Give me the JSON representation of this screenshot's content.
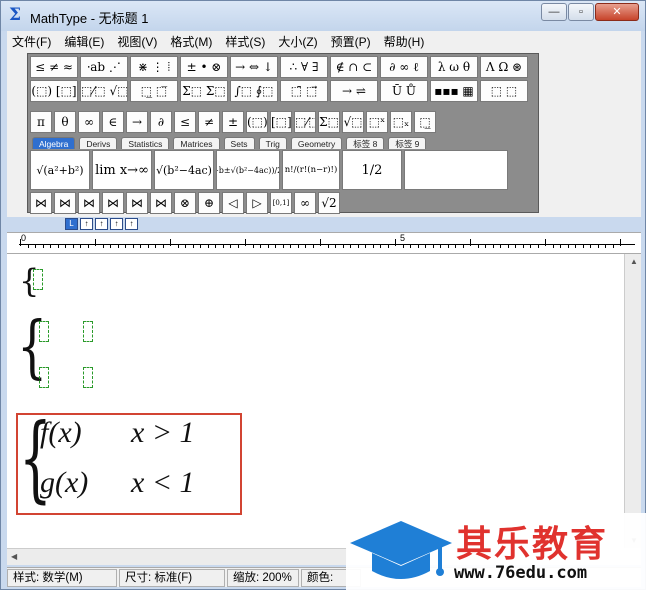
{
  "window": {
    "app_name": "MathType",
    "title": "MathType - 无标题 1",
    "controls": {
      "minimize": "—",
      "maximize": "▫",
      "close": "✕"
    }
  },
  "menu": [
    "文件(F)",
    "编辑(E)",
    "视图(V)",
    "格式(M)",
    "样式(S)",
    "大小(Z)",
    "预置(P)",
    "帮助(H)"
  ],
  "palette": {
    "row1": [
      "≤ ≠ ≈",
      "⸱ab ⋰",
      "⋇ ⋮ ⦙",
      "± • ⊗",
      "→ ⇔ ↓",
      "∴ ∀ ∃",
      "∉ ∩ ⊂",
      "∂ ∞ ℓ",
      "λ ω θ",
      "Λ Ω ⊛"
    ],
    "row2": [
      "(⬚) [⬚]",
      "⬚⁄⬚ √⬚",
      "⬚̲ ⬚̅",
      "Σ⬚ Σ⬚",
      "∫⬚ ∮⬚",
      "⬚̄ ⬚⃗",
      "→ ⇌",
      "Ū Ů",
      "▪▪▪ ▦",
      "⬚ ⬚"
    ],
    "row3": [
      "π",
      "θ",
      "∞",
      "∈",
      "→",
      "∂",
      "≤",
      "≠",
      "±",
      "(⬚)",
      "[⬚]",
      "⬚⁄⬚",
      "Σ⬚",
      "√⬚",
      "⬚ˣ",
      "⬚ₓ",
      "⬚̲"
    ],
    "tabs": [
      "Algebra",
      "Derivs",
      "Statistics",
      "Matrices",
      "Sets",
      "Trig",
      "Geometry",
      "标签 8",
      "标签 9"
    ],
    "templates": [
      "√(a²+b²)",
      "lim x→∞",
      "√(b²−4ac)",
      "(−b±√(b²−4ac))/2a",
      "n!/(r!(n−r)!)",
      "1/2"
    ],
    "row5": [
      "⋈",
      "⋈",
      "⋈",
      "⋈",
      "⋈",
      "⋈",
      "⊗",
      "⊕",
      "◁",
      "▷",
      "[0,1]",
      "∞",
      "√2"
    ],
    "size_buttons": [
      "L",
      "↑",
      "↑",
      "↑",
      "↑"
    ]
  },
  "ruler": {
    "labels": [
      "0",
      "5"
    ]
  },
  "equations": {
    "line1_left": "f(x)",
    "line1_right": "x > 1",
    "line2_left": "g(x)",
    "line2_right": "x < 1"
  },
  "status": [
    "样式: 数学(M)",
    "尺寸: 标准(F)",
    "缩放: 200%",
    "颜色:"
  ],
  "watermark": {
    "brand": "其乐教育",
    "url": "www.76edu.com"
  }
}
